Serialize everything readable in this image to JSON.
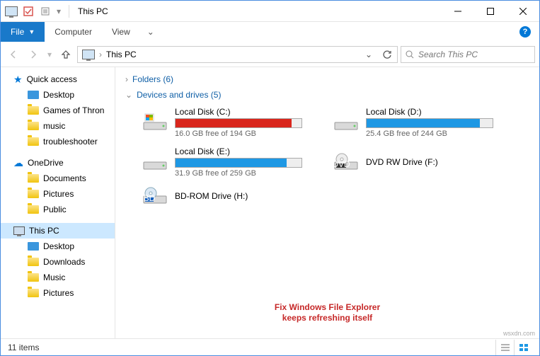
{
  "window": {
    "title": "This PC",
    "qat_checkbox_checked": true
  },
  "ribbon": {
    "file": "File",
    "computer": "Computer",
    "view": "View"
  },
  "nav": {
    "path": "This PC",
    "search_placeholder": "Search This PC"
  },
  "sidebar": {
    "quick_access": "Quick access",
    "qa_items": [
      {
        "label": "Desktop",
        "icon": "desktop"
      },
      {
        "label": "Games of Thron",
        "icon": "folder"
      },
      {
        "label": "music",
        "icon": "folder"
      },
      {
        "label": "troubleshooter",
        "icon": "folder"
      }
    ],
    "onedrive": "OneDrive",
    "od_items": [
      {
        "label": "Documents",
        "icon": "folder"
      },
      {
        "label": "Pictures",
        "icon": "folder"
      },
      {
        "label": "Public",
        "icon": "folder"
      }
    ],
    "this_pc": "This PC",
    "pc_items": [
      {
        "label": "Desktop",
        "icon": "desktop"
      },
      {
        "label": "Downloads",
        "icon": "folder"
      },
      {
        "label": "Music",
        "icon": "folder"
      },
      {
        "label": "Pictures",
        "icon": "folder"
      }
    ]
  },
  "content": {
    "folders_header": "Folders (6)",
    "drives_header": "Devices and drives (5)",
    "drives": [
      {
        "name": "Local Disk (C:)",
        "info": "16.0 GB free of 194 GB",
        "fill_pct": 92,
        "color": "#d9261c",
        "icon": "os"
      },
      {
        "name": "Local Disk (D:)",
        "info": "25.4 GB free of 244 GB",
        "fill_pct": 90,
        "color": "#1e98e4",
        "icon": "hdd"
      },
      {
        "name": "Local Disk (E:)",
        "info": "31.9 GB free of 259 GB",
        "fill_pct": 88,
        "color": "#1e98e4",
        "icon": "hdd"
      },
      {
        "name": "DVD RW Drive (F:)",
        "info": "",
        "fill_pct": 0,
        "color": "",
        "icon": "dvd"
      },
      {
        "name": "BD-ROM Drive (H:)",
        "info": "",
        "fill_pct": 0,
        "color": "",
        "icon": "bd"
      }
    ]
  },
  "overlay": {
    "line1": "Fix Windows File Explorer",
    "line2": "keeps refreshing itself"
  },
  "status": {
    "items": "11 items"
  },
  "watermark": "wsxdn.com"
}
